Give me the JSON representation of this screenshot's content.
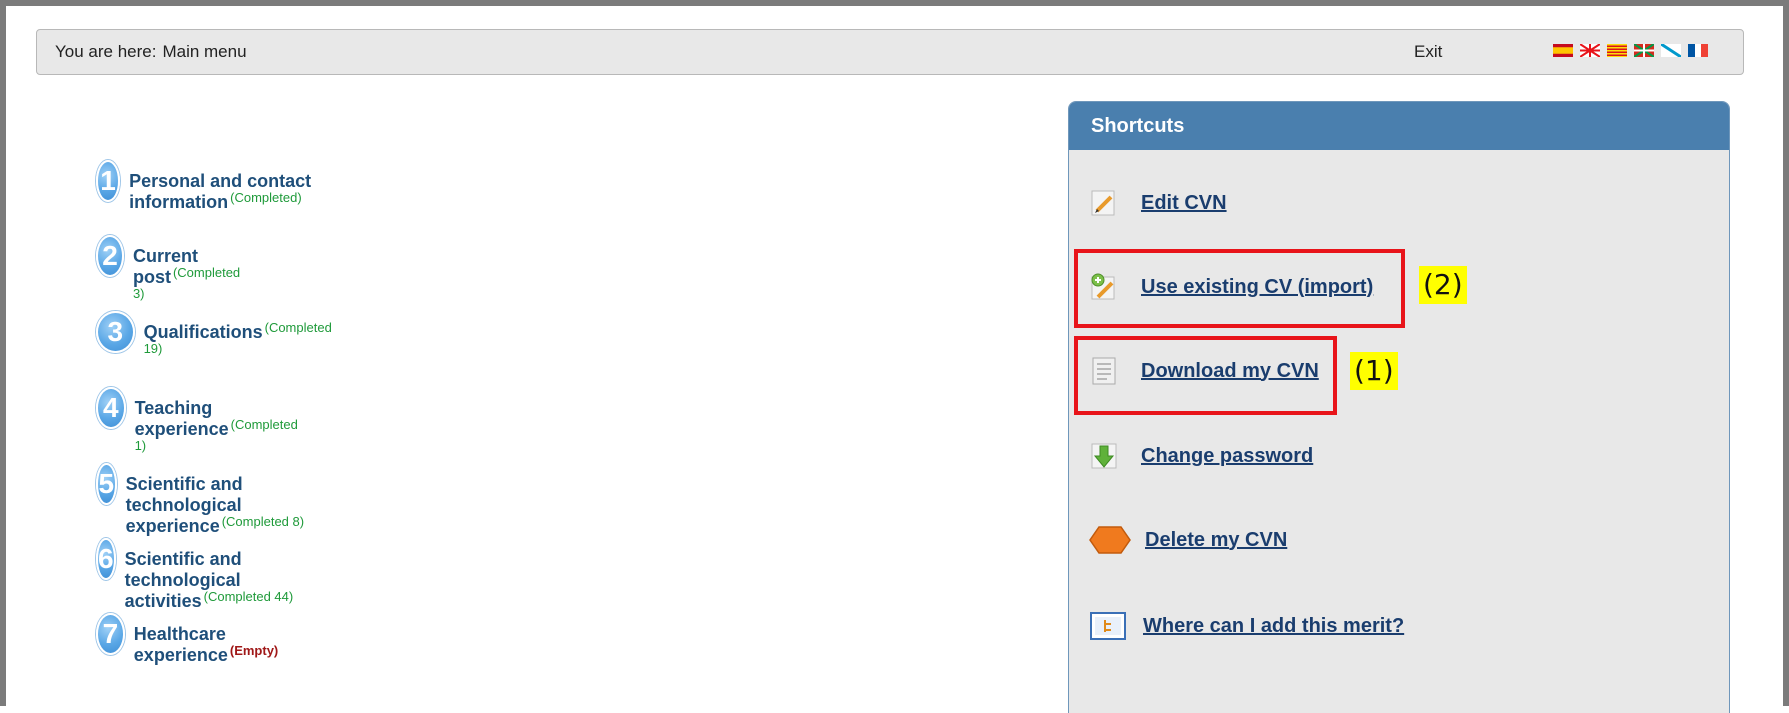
{
  "topbar": {
    "breadcrumb_prefix": "You are here:",
    "breadcrumb_current": "Main menu",
    "exit_label": "Exit",
    "languages": [
      "spanish-flag-icon",
      "uk-flag-icon",
      "catalan-flag-icon",
      "basque-flag-icon",
      "galician-flag-icon",
      "french-flag-icon"
    ]
  },
  "menu": {
    "items": [
      {
        "number": "1",
        "label": "Personal and contact information",
        "status": "(Completed)",
        "state": "ok"
      },
      {
        "number": "2",
        "label": "Current post",
        "status": "(Completed 3)",
        "state": "ok"
      },
      {
        "number": "3",
        "label": "Qualifications",
        "status": "(Completed 19)",
        "state": "ok"
      },
      {
        "number": "4",
        "label": "Teaching experience",
        "status": "(Completed 1)",
        "state": "ok"
      },
      {
        "number": "5",
        "label": "Scientific and technological experience",
        "status": "(Completed 8)",
        "state": "ok"
      },
      {
        "number": "6",
        "label": "Scientific and technological activities",
        "status": "(Completed 44)",
        "state": "ok"
      },
      {
        "number": "7",
        "label": "Healthcare experience",
        "status": "(Empty)",
        "state": "empty"
      }
    ]
  },
  "shortcuts": {
    "title": "Shortcuts",
    "items": [
      {
        "label": "Edit CVN",
        "icon": "pencil-edit-icon"
      },
      {
        "label": "Use existing CV (import)",
        "icon": "import-pencil-icon"
      },
      {
        "label": "Download my CVN",
        "icon": "document-icon"
      },
      {
        "label": "Change password",
        "icon": "green-arrow-down-icon"
      },
      {
        "label": "Delete my CVN",
        "icon": "orange-hexagon-icon"
      },
      {
        "label": "Where can I add this merit?",
        "icon": "tree-structure-icon"
      }
    ]
  },
  "annotations": {
    "tag_1": "(1)",
    "tag_2": "(2)",
    "highlight_color": "#e8141a",
    "tag_color": "#ffff00"
  },
  "colors": {
    "header_blue": "#4a7fae",
    "link_blue": "#1a3d6e",
    "completed_green": "#1f9a3a",
    "empty_red": "#a01818"
  }
}
